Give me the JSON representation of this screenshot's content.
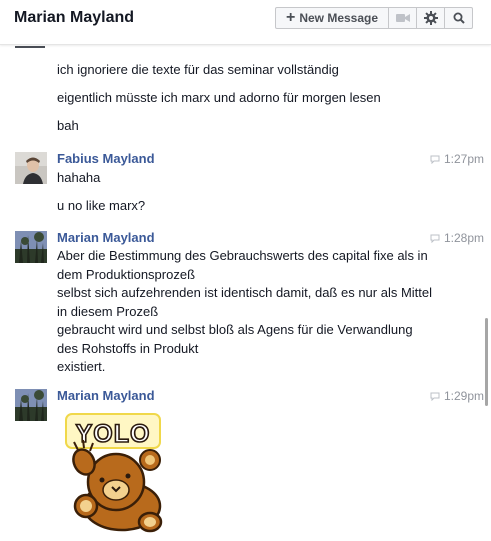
{
  "header": {
    "title": "Marian Mayland",
    "new_message_label": "New Message"
  },
  "messages_top": [
    "ich ignoriere die texte für das seminar vollständig",
    "eigentlich müsste ich marx und adorno für morgen lesen",
    "bah"
  ],
  "groups": [
    {
      "sender": "Fabius Mayland",
      "time": "1:27pm",
      "lines": [
        "hahaha",
        "u no like marx?"
      ]
    },
    {
      "sender": "Marian Mayland",
      "time": "1:28pm",
      "lines": [
        "Aber die Bestimmung des Gebrauchswerts des capital fixe als in dem Produktionsprozeß",
        "selbst sich aufzehrenden ist identisch damit, daß es nur als Mittel in diesem Prozeß",
        "gebraucht wird und selbst bloß als Agens für die Verwandlung des Rohstoffs in Produkt",
        "existiert."
      ]
    },
    {
      "sender": "Marian Mayland",
      "time": "1:29pm",
      "sticker_text": "YOLO"
    }
  ],
  "colors": {
    "sender": "#3b5998",
    "time": "#90949c",
    "text": "#141823"
  },
  "icons": [
    "plus-icon",
    "video-camera-icon",
    "gear-icon",
    "search-icon",
    "chat-bubble-icon"
  ]
}
